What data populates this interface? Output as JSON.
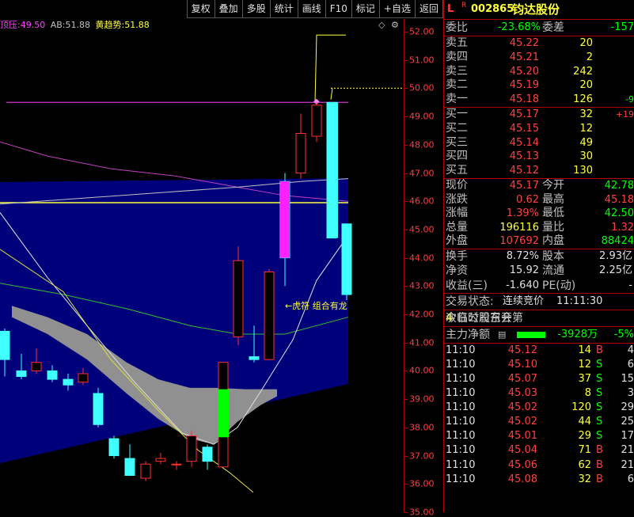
{
  "toolbar": {
    "buttons": [
      "复权",
      "叠加",
      "多股",
      "统计",
      "画线",
      "F10",
      "标记",
      "+自选",
      "返回"
    ]
  },
  "indicators": {
    "items": [
      {
        "label": "顶压:",
        "value": "49.50",
        "color": "#ff40ff"
      },
      {
        "label": "AB:",
        "value": "51.88",
        "color": "#c0c0c0"
      },
      {
        "label": "黄趋势:",
        "value": "51.88",
        "color": "#ffff40"
      }
    ],
    "diamond_icon": "◇",
    "settings_icon": "⚙"
  },
  "chart": {
    "y_ticks": [
      "52.00",
      "51.00",
      "50.00",
      "49.00",
      "48.00",
      "47.00",
      "46.00",
      "45.00",
      "44.00",
      "43.00",
      "42.00",
      "41.00",
      "40.00",
      "39.00",
      "38.00",
      "37.00",
      "36.00",
      "35.00"
    ],
    "annotation": "←虎符 组合有龙",
    "colors": {
      "up": "#ff3030",
      "down": "#40ffff",
      "bg": "#00007a"
    }
  },
  "panel": {
    "header": {
      "l": "L",
      "r": "R",
      "code": "002865",
      "name": "钧达股份"
    },
    "ratio": {
      "label": "委比",
      "value": "-23.68%",
      "label2": "委差",
      "value2": "-157"
    },
    "asks": [
      {
        "label": "卖五",
        "price": "45.22",
        "vol": "20",
        "chg": ""
      },
      {
        "label": "卖四",
        "price": "45.21",
        "vol": "2",
        "chg": ""
      },
      {
        "label": "卖三",
        "price": "45.20",
        "vol": "242",
        "chg": ""
      },
      {
        "label": "卖二",
        "price": "45.19",
        "vol": "20",
        "chg": ""
      },
      {
        "label": "卖一",
        "price": "45.18",
        "vol": "126",
        "chg": "-9"
      }
    ],
    "bids": [
      {
        "label": "买一",
        "price": "45.17",
        "vol": "32",
        "chg": "+19"
      },
      {
        "label": "买二",
        "price": "45.15",
        "vol": "12",
        "chg": ""
      },
      {
        "label": "买三",
        "price": "45.14",
        "vol": "49",
        "chg": ""
      },
      {
        "label": "买四",
        "price": "45.13",
        "vol": "30",
        "chg": ""
      },
      {
        "label": "买五",
        "price": "45.12",
        "vol": "130",
        "chg": ""
      }
    ],
    "quote": [
      {
        "l1": "现价",
        "v1": "45.17",
        "c1": "red",
        "l2": "今开",
        "v2": "42.78",
        "c2": "grn"
      },
      {
        "l1": "涨跌",
        "v1": "0.62",
        "c1": "red",
        "l2": "最高",
        "v2": "45.18",
        "c2": "red"
      },
      {
        "l1": "涨幅",
        "v1": "1.39%",
        "c1": "red",
        "l2": "最低",
        "v2": "42.50",
        "c2": "grn"
      },
      {
        "l1": "总量",
        "v1": "196116",
        "c1": "yel",
        "l2": "量比",
        "v2": "1.32",
        "c2": "red"
      },
      {
        "l1": "外盘",
        "v1": "107692",
        "c1": "red",
        "l2": "内盘",
        "v2": "88424",
        "c2": "grn"
      }
    ],
    "finance": [
      {
        "l1": "换手",
        "v1": "8.72%",
        "l2": "股本",
        "v2": "2.93亿"
      },
      {
        "l1": "净资",
        "v1": "15.92",
        "l2": "流通",
        "v2": "2.25亿"
      },
      {
        "l1": "收益(三)",
        "v1": "-1.640",
        "l2": "PE(动)",
        "v2": "-"
      }
    ],
    "status": {
      "label": "交易状态:",
      "value": "连续竞价",
      "time": "11:11:30"
    },
    "notice": {
      "pre": "今日公司召开第",
      "num": "4",
      "post": "次临时股东会"
    },
    "mainflow": {
      "label": "主力净额",
      "value": "-3928万",
      "pct": "-5%"
    },
    "ticks": [
      {
        "t": "11:10",
        "p": "45.12",
        "v": "14",
        "s": "B",
        "n": "4"
      },
      {
        "t": "11:10",
        "p": "45.10",
        "v": "12",
        "s": "S",
        "n": "6"
      },
      {
        "t": "11:10",
        "p": "45.07",
        "v": "37",
        "s": "S",
        "n": "15"
      },
      {
        "t": "11:10",
        "p": "45.03",
        "v": "8",
        "s": "S",
        "n": "3"
      },
      {
        "t": "11:10",
        "p": "45.02",
        "v": "120",
        "s": "S",
        "n": "29"
      },
      {
        "t": "11:10",
        "p": "45.02",
        "v": "44",
        "s": "S",
        "n": "25"
      },
      {
        "t": "11:10",
        "p": "45.01",
        "v": "29",
        "s": "S",
        "n": "17"
      },
      {
        "t": "11:10",
        "p": "45.04",
        "v": "71",
        "s": "B",
        "n": "21"
      },
      {
        "t": "11:10",
        "p": "45.06",
        "v": "62",
        "s": "B",
        "n": "21"
      },
      {
        "t": "11:10",
        "p": "45.08",
        "v": "32",
        "s": "B",
        "n": "6"
      }
    ]
  }
}
